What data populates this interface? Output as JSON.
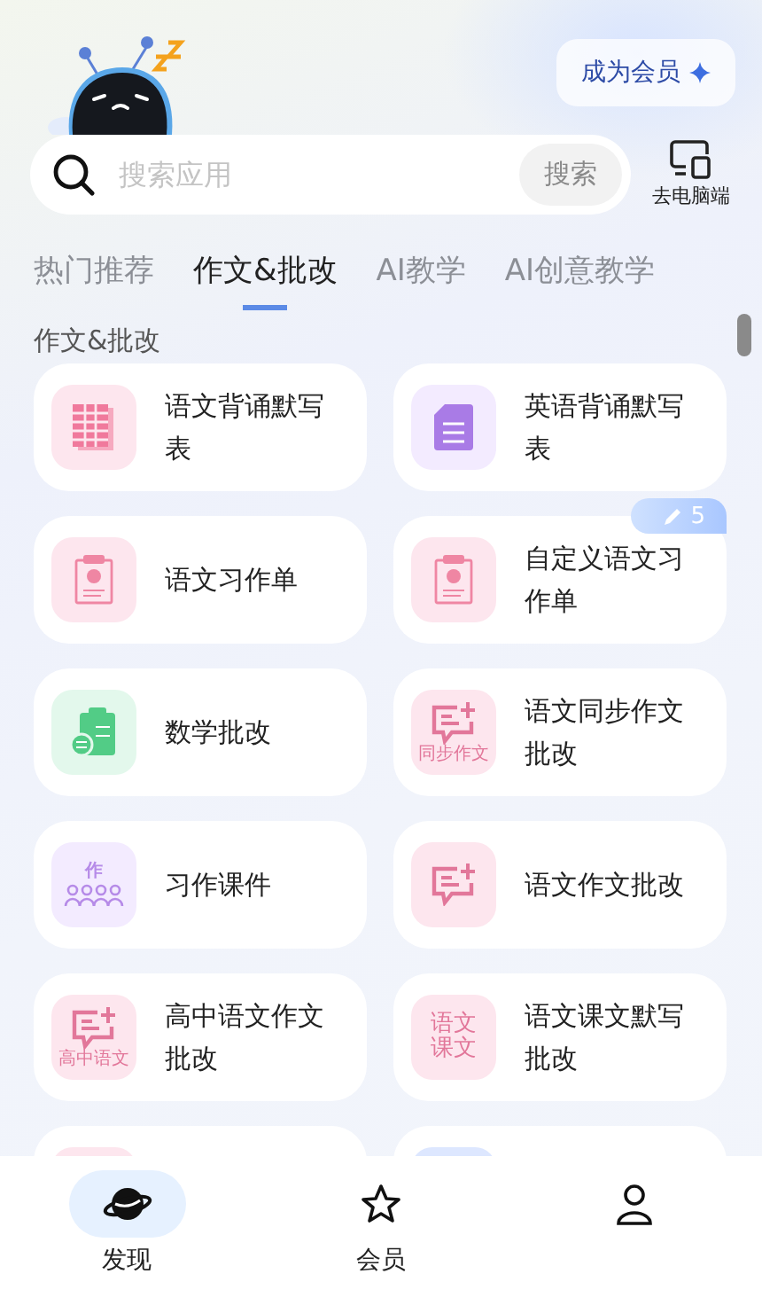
{
  "header": {
    "member_button": "成为会员"
  },
  "search": {
    "placeholder": "搜索应用",
    "button": "搜索"
  },
  "desktop_link": {
    "label": "去电脑端"
  },
  "tabs": [
    {
      "label": "热门推荐",
      "selected": false
    },
    {
      "label": "作文&批改",
      "selected": true
    },
    {
      "label": "AI教学",
      "selected": false
    },
    {
      "label": "AI创意教学",
      "selected": false
    }
  ],
  "section_title": "作文&批改",
  "apps": [
    {
      "name": "语文背诵默写表",
      "kind": "sheet"
    },
    {
      "name": "英语背诵默写表",
      "kind": "doc"
    },
    {
      "name": "语文习作单",
      "kind": "clipboard"
    },
    {
      "name": "自定义语文习作单",
      "kind": "clipboard",
      "badge": "5"
    },
    {
      "name": "数学批改",
      "kind": "math"
    },
    {
      "name": "语文同步作文批改",
      "kind": "chat",
      "icon_text": "同步作文"
    },
    {
      "name": "习作课件",
      "kind": "class",
      "icon_text": "作"
    },
    {
      "name": "语文作文批改",
      "kind": "chat"
    },
    {
      "name": "高中语文作文批改",
      "kind": "chat",
      "icon_text": "高中语文"
    },
    {
      "name": "语文课文默写批改",
      "kind": "words",
      "icon_text": "语文课文"
    },
    {
      "kind": "pink"
    },
    {
      "kind": "blue"
    }
  ],
  "nav": [
    {
      "label": "发现",
      "kind": "planet",
      "selected": true
    },
    {
      "label": "会员",
      "kind": "star",
      "selected": false
    },
    {
      "kind": "person",
      "selected": false
    }
  ]
}
